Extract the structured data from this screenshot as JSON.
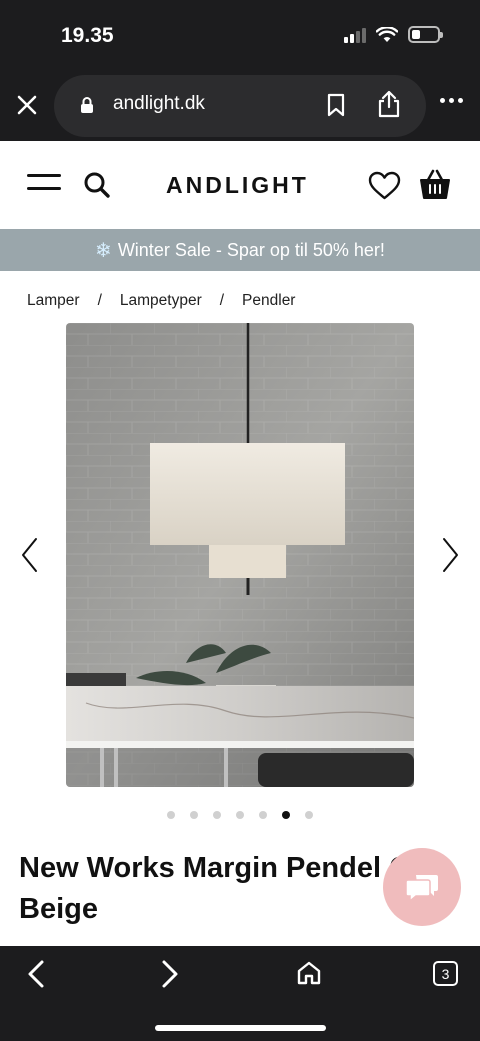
{
  "status_bar": {
    "time": "19.35"
  },
  "browser": {
    "url": "andlight.dk",
    "tab_count": "3"
  },
  "header": {
    "logo": "ANDLIGHT"
  },
  "banner": {
    "icon": "snowflake-icon",
    "text": "Winter Sale - Spar op til 50% her!"
  },
  "breadcrumb": {
    "items": [
      "Lamper",
      "Lampetyper",
      "Pendler"
    ],
    "separator": "/"
  },
  "gallery": {
    "total_images": 7,
    "active_index": 5
  },
  "product": {
    "title": "New Works Margin Pendel Ø90 Beige"
  },
  "colors": {
    "chrome": "#1c1c1e",
    "banner": "#9aa6ab",
    "chat": "#f0bcbd"
  }
}
